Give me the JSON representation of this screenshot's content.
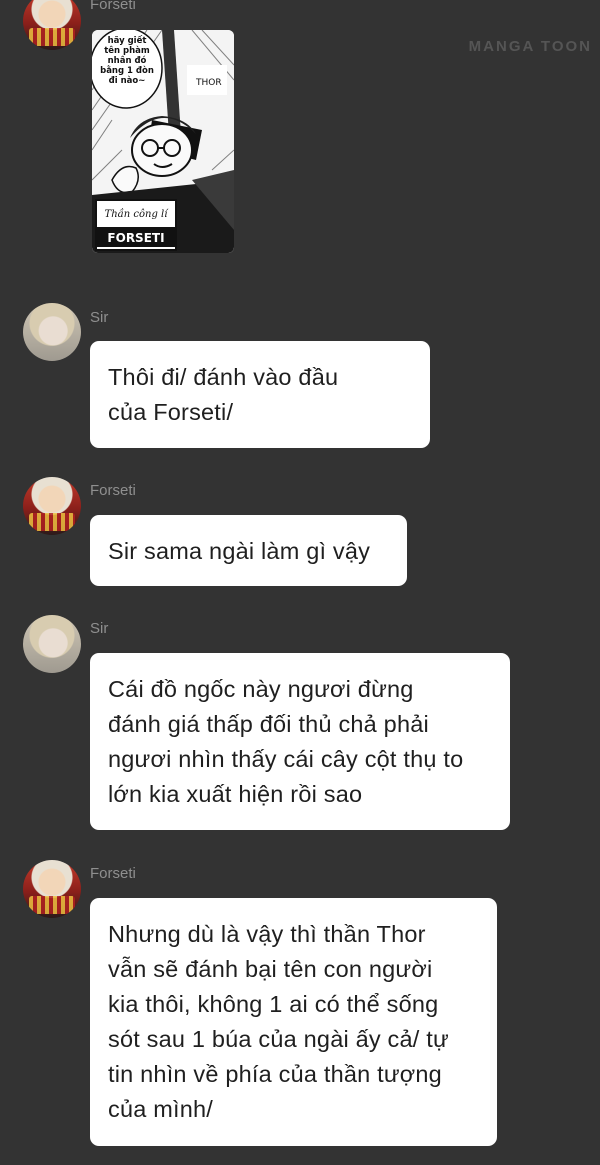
{
  "messages": [
    {
      "sender": "Forseti",
      "type": "image",
      "image": {
        "bubble_text": "hãy giết tên phàm nhân đó bằng 1 đòn đi nào~",
        "sfx": "THOR",
        "caption_small": "Thần công lí",
        "caption_big": "FORSETI"
      }
    },
    {
      "sender": "Sir",
      "type": "text",
      "lines": [
        "Thôi đi/ đánh vào đầu",
        "của Forseti/"
      ]
    },
    {
      "sender": "Forseti",
      "type": "text",
      "lines": [
        "Sir sama ngài làm gì vậy"
      ]
    },
    {
      "sender": "Sir",
      "type": "text",
      "lines": [
        "Cái đồ ngốc này ngươi đừng",
        "đánh giá thấp đối thủ chả phải",
        "ngươi nhìn thấy cái cây cột thụ to",
        "lớn kia xuất hiện rồi sao"
      ]
    },
    {
      "sender": "Forseti",
      "type": "text",
      "lines": [
        "Nhưng dù là vậy thì thần Thor",
        "vẫn sẽ đánh bại tên con người",
        "kia thôi, không 1 ai có thể sống",
        "sót sau 1 búa của ngài ấy cả/ tự",
        "tin nhìn về phía của thần tượng",
        "của mình/"
      ]
    }
  ],
  "watermark": "MANGA TOON"
}
